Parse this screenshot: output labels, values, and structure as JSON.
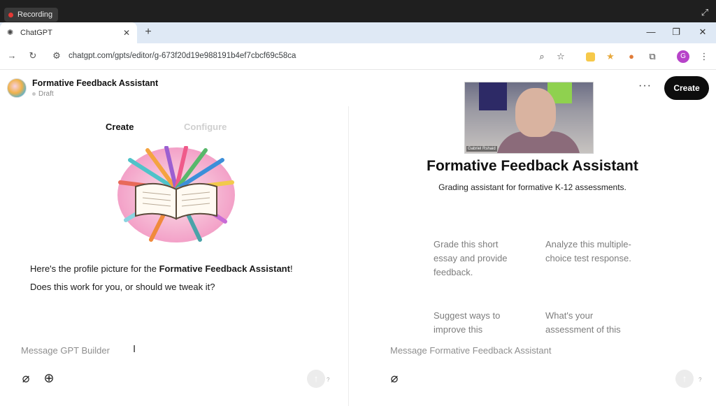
{
  "recording": {
    "label": "Recording"
  },
  "browser": {
    "tab_title": "ChatGPT",
    "url": "chatgpt.com/gpts/editor/g-673f20d19e988191b4ef7cbcf69c58ca",
    "profile_initial": "G"
  },
  "header": {
    "gpt_name": "Formative Feedback Assistant",
    "status": "Draft",
    "more_label": "···",
    "create_label": "Create"
  },
  "left": {
    "tabs": [
      "Create",
      "Configure"
    ],
    "message_line1_pre": "Here's the profile picture for the ",
    "message_line1_bold": "Formative Feedback Assistant",
    "message_line1_post": "!",
    "message_line2": "Does this work for you, or should we tweak it?",
    "input_placeholder": "Message GPT Builder"
  },
  "right": {
    "webcam_name": "Gabriel Rshaid",
    "title": "Formative Feedback Assistant",
    "description": "Grading assistant for formative K-12 assessments.",
    "starters": [
      "Grade this short essay and provide feedback.",
      "Analyze this multiple-choice test response.",
      "Suggest ways to improve this",
      "What's your assessment of this"
    ],
    "input_placeholder": "Message Formative Feedback Assistant"
  },
  "help_label": "?"
}
